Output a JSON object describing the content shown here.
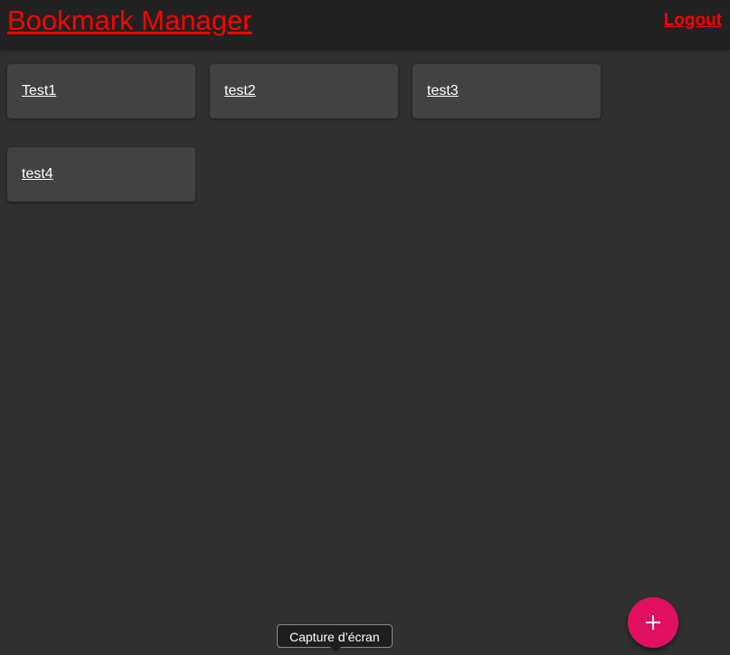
{
  "header": {
    "title": "Bookmark Manager",
    "logout_label": "Logout"
  },
  "bookmarks": [
    {
      "label": "Test1"
    },
    {
      "label": "test2"
    },
    {
      "label": "test3"
    },
    {
      "label": "test4"
    }
  ],
  "fab": {
    "icon": "plus-icon"
  },
  "tooltip": {
    "text": "Capture d’écran"
  },
  "colors": {
    "accent_red": "#ff0000",
    "fab_pink": "#e0105e",
    "background": "#303030",
    "card": "#424242",
    "toolbar": "#212121"
  }
}
